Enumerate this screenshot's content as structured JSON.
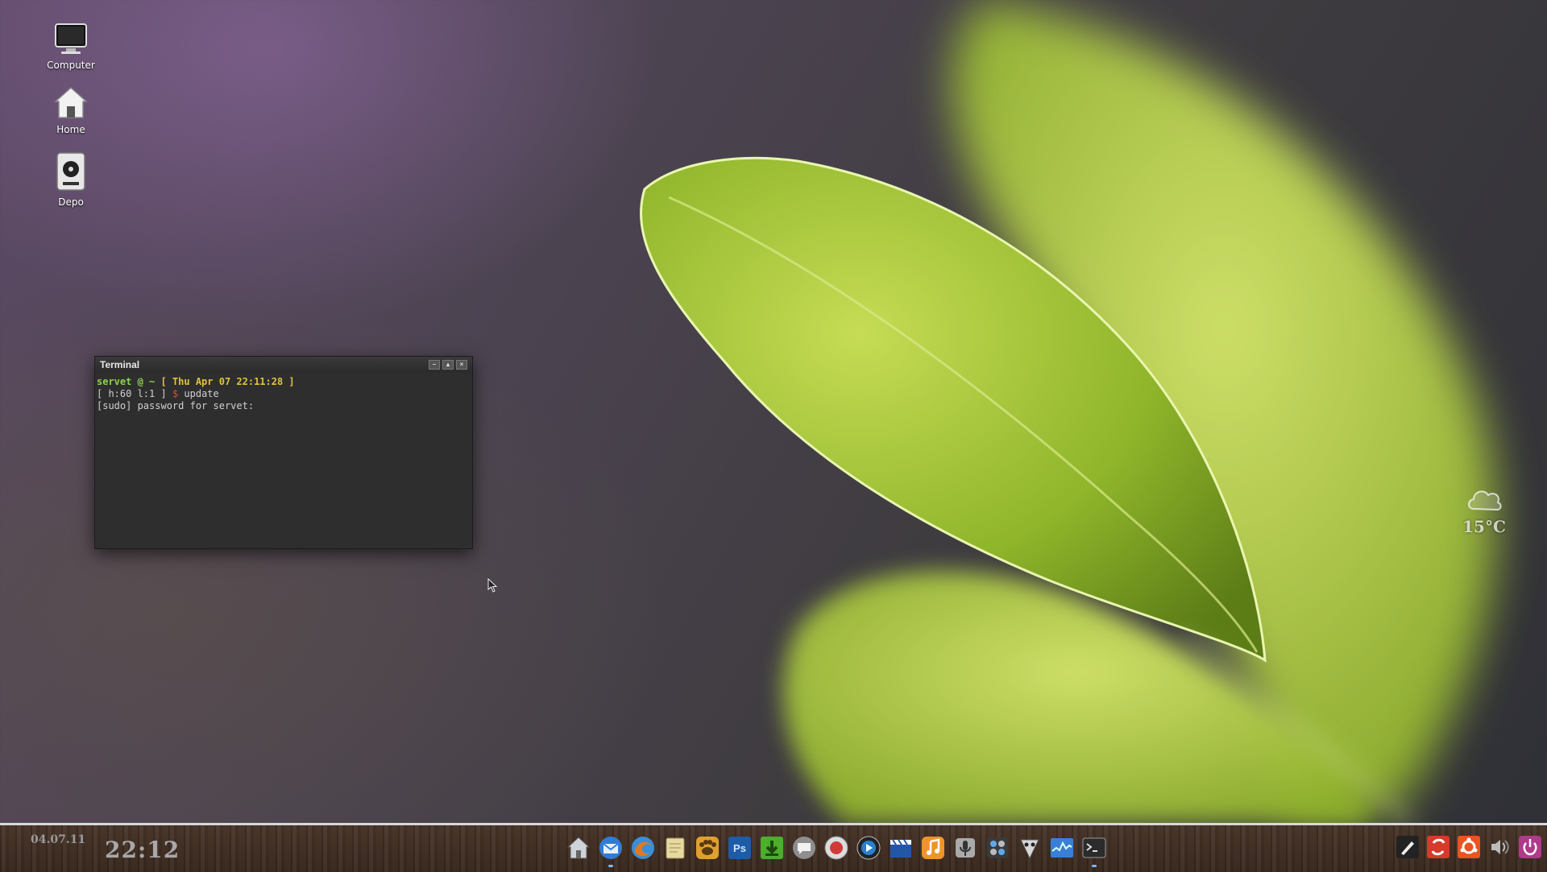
{
  "desktop": {
    "icons": [
      {
        "label": "Computer",
        "icon": "monitor-icon"
      },
      {
        "label": "Home",
        "icon": "home-folder-icon"
      },
      {
        "label": "Depo",
        "icon": "drive-icon"
      }
    ]
  },
  "terminal": {
    "title": "Terminal",
    "line1_user": "servet @ ~",
    "line1_date": "[ Thu Apr 07 22:11:28 ]",
    "line2_prefix": "[ h:60 l:1 ]",
    "line2_prompt": "$",
    "line2_command": "update",
    "line3": "[sudo] password for servet:"
  },
  "weather": {
    "temperature": "15°C",
    "icon": "cloud-icon"
  },
  "panel": {
    "date": "04.07.11",
    "time": "22:12",
    "dock": [
      {
        "name": "home",
        "icon": "home-icon",
        "color": "#cfd3d8"
      },
      {
        "name": "thunderbird",
        "icon": "mail-icon",
        "color": "#2f7bd6"
      },
      {
        "name": "firefox",
        "icon": "browser-icon",
        "color": "#3b8ed8"
      },
      {
        "name": "notes",
        "icon": "notes-icon",
        "color": "#e8d9a0"
      },
      {
        "name": "gimp",
        "icon": "paw-icon",
        "color": "#e0a030"
      },
      {
        "name": "photoshop",
        "label": "Ps",
        "icon": "photoshop-icon",
        "color": "#1e5ca8"
      },
      {
        "name": "downloads",
        "icon": "download-icon",
        "color": "#4cae2d"
      },
      {
        "name": "chat",
        "icon": "chat-icon",
        "color": "#8e8e8e"
      },
      {
        "name": "recorder",
        "icon": "record-icon",
        "color": "#d23a3a"
      },
      {
        "name": "media-player",
        "icon": "play-icon",
        "color": "#2a7fcf"
      },
      {
        "name": "video-editor",
        "icon": "clapper-icon",
        "color": "#2456a8"
      },
      {
        "name": "music",
        "icon": "music-icon",
        "color": "#f0942a"
      },
      {
        "name": "microphone",
        "icon": "mic-icon",
        "color": "#aaaaaa"
      },
      {
        "name": "settings",
        "icon": "control-icon",
        "color": "#6b6b6b"
      },
      {
        "name": "pidgin",
        "icon": "pidgin-icon",
        "color": "#d8d8d8"
      },
      {
        "name": "system-monitor",
        "icon": "monitor-graph-icon",
        "color": "#3a7fd6"
      },
      {
        "name": "terminal",
        "icon": "terminal-icon",
        "color": "#2b2b2b"
      }
    ],
    "tray": [
      {
        "name": "pen-tool",
        "icon": "pen-icon",
        "color": "#222222"
      },
      {
        "name": "sync",
        "icon": "sync-icon",
        "color": "#d63a2a"
      },
      {
        "name": "ubuntu",
        "icon": "ubuntu-icon",
        "color": "#e95420"
      },
      {
        "name": "volume",
        "icon": "volume-icon",
        "color": "#bbbbbb"
      },
      {
        "name": "session",
        "icon": "power-icon",
        "color": "#b03a8a"
      }
    ]
  }
}
